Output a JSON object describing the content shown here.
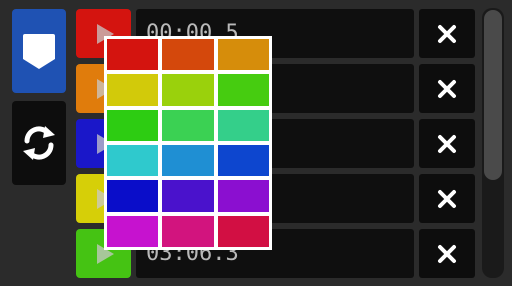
{
  "tools": {
    "tag_icon": "tag-icon",
    "loop_icon": "loop-icon",
    "tag_color": "#1f52b3",
    "loop_color": "#0d0d0d"
  },
  "rows": [
    {
      "play_color": "#d4140f",
      "time": "00:00.5"
    },
    {
      "play_color": "#e07c0c",
      "time": ""
    },
    {
      "play_color": "#1a17c9",
      "time": ""
    },
    {
      "play_color": "#d6cf08",
      "time": ""
    },
    {
      "play_color": "#45c313",
      "time": "03:06.3"
    }
  ],
  "close_icon": "close-icon",
  "play_icon": "play-icon",
  "palette": [
    "#d4140f",
    "#d4480c",
    "#d68d0b",
    "#d2ca0a",
    "#9ad10c",
    "#46cc10",
    "#2dcc12",
    "#3bd153",
    "#34cf8a",
    "#2fc9cd",
    "#1f8fd3",
    "#0d46cf",
    "#0a0dc9",
    "#4a12cc",
    "#8b0fd0",
    "#c612cf",
    "#d2147e",
    "#d20f43"
  ]
}
